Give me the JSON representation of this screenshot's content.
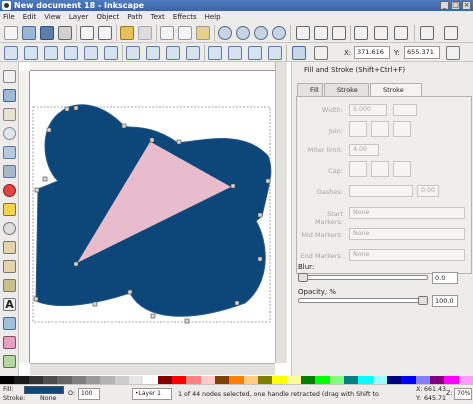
{
  "window": {
    "title": "New document 18 - Inkscape",
    "min": "_",
    "max": "□",
    "close": "×"
  },
  "menu": [
    "File",
    "Edit",
    "View",
    "Layer",
    "Object",
    "Path",
    "Text",
    "Effects",
    "Help"
  ],
  "node_toolbar": {
    "x_label": "X:",
    "x_value": "371.616",
    "y_label": "Y:",
    "y_value": "655.371"
  },
  "dialog": {
    "title": "Fill and Stroke (Shift+Ctrl+F)",
    "tabs": [
      "Fill",
      "Stroke paint",
      "Stroke style"
    ],
    "active_tab": "Stroke style",
    "stroke_style": {
      "width_label": "Width:",
      "width_value": "5.000",
      "join_label": "Join:",
      "miter_label": "Miter limit:",
      "miter_value": "4.00",
      "cap_label": "Cap:",
      "dashes_label": "Dashes:",
      "dashes_value": "0.00",
      "start_label": "Start Markers:",
      "start_value": "None",
      "mid_label": "Mid Markers:",
      "mid_value": "None",
      "end_label": "End Markers:",
      "end_value": "None"
    },
    "blur_label": "Blur:",
    "blur_value": "0.0",
    "opacity_label": "Opacity, %",
    "opacity_value": "100.0"
  },
  "status": {
    "fill_label": "Fill:",
    "stroke_label": "Stroke:",
    "stroke_value": "None",
    "opacity_label": "O:",
    "opacity_value": "100",
    "layer": "•Layer 1",
    "message": "1 of 44 nodes selected, one handle retracted (drag with Shift to",
    "x_label": "X:",
    "x_value": "661.43",
    "y_label": "Y:",
    "y_value": "645.71",
    "zoom_label": "Z:",
    "zoom_value": "70%"
  },
  "colors": {
    "fill": "#0d4678",
    "triangle": "#e8bccc",
    "accent": "#3a64a6"
  },
  "palette": [
    "#000000",
    "#1a1a1a",
    "#333333",
    "#4d4d4d",
    "#666666",
    "#808080",
    "#999999",
    "#b3b3b3",
    "#cccccc",
    "#e6e6e6",
    "#ffffff",
    "#800000",
    "#ff0000",
    "#ff8080",
    "#ffcccc",
    "#804000",
    "#ff8000",
    "#ffcc80",
    "#808000",
    "#ffff00",
    "#ffff99",
    "#008000",
    "#00ff00",
    "#80ff80",
    "#008080",
    "#00ffff",
    "#99ffff",
    "#000080",
    "#0000ff",
    "#8080ff",
    "#800080",
    "#ff00ff",
    "#ff99ff"
  ]
}
